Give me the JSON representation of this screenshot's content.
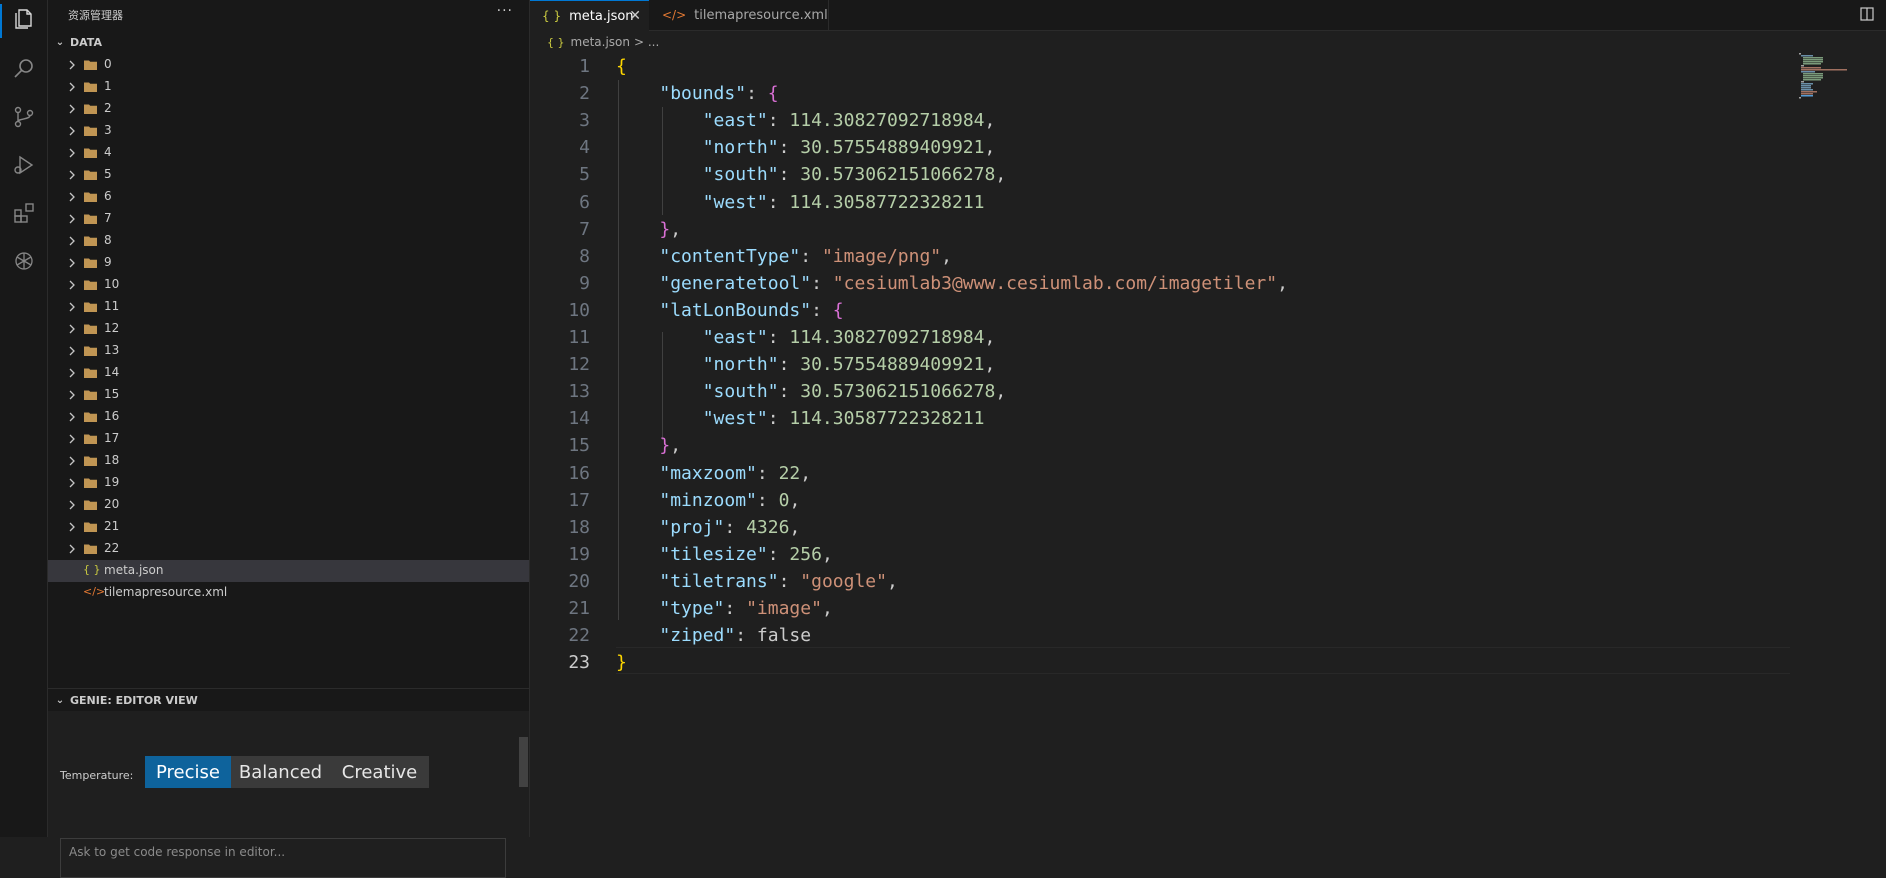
{
  "sidebar": {
    "title": "资源管理器",
    "more": "···",
    "root_label": "DATA",
    "folders": [
      "0",
      "1",
      "2",
      "3",
      "4",
      "5",
      "6",
      "7",
      "8",
      "9",
      "10",
      "11",
      "12",
      "13",
      "14",
      "15",
      "16",
      "17",
      "18",
      "19",
      "20",
      "21",
      "22"
    ],
    "files": [
      {
        "name": "meta.json",
        "icon": "{ }",
        "selected": true
      },
      {
        "name": "tilemapresource.xml",
        "icon": "</>",
        "selected": false
      }
    ]
  },
  "genie": {
    "header": "GENIE: EDITOR VIEW",
    "temperature_label": "Temperature:",
    "options": [
      "Precise",
      "Balanced",
      "Creative"
    ],
    "selected": "Precise",
    "input_placeholder": "Ask to get code response in editor..."
  },
  "tabs": [
    {
      "label": "meta.json",
      "icon": "{ }",
      "active": true
    },
    {
      "label": "tilemapresource.xml",
      "icon": "</>",
      "active": false
    }
  ],
  "breadcrumb": {
    "file": "meta.json",
    "rest": "> ..."
  },
  "editor": {
    "current_line": 23,
    "lines": [
      "{",
      "    \"bounds\": {",
      "        \"east\": 114.30827092718984,",
      "        \"north\": 30.57554889409921,",
      "        \"south\": 30.573062151066278,",
      "        \"west\": 114.30587722328211",
      "    },",
      "    \"contentType\": \"image/png\",",
      "    \"generatetool\": \"cesiumlab3@www.cesiumlab.com/imagetiler\",",
      "    \"latLonBounds\": {",
      "        \"east\": 114.30827092718984,",
      "        \"north\": 30.57554889409921,",
      "        \"south\": 30.573062151066278,",
      "        \"west\": 114.30587722328211",
      "    },",
      "    \"maxzoom\": 22,",
      "    \"minzoom\": 0,",
      "    \"proj\": 4326,",
      "    \"tilesize\": 256,",
      "    \"tiletrans\": \"google\",",
      "    \"type\": \"image\",",
      "    \"ziped\": false",
      "}"
    ]
  },
  "colors": {
    "accent": "#0078d4",
    "key": "#9cdcfe",
    "string": "#ce9178",
    "number": "#b5cea8",
    "boolean": "#569cd6",
    "brace": "#ffd700",
    "nested_brace": "#da70d6",
    "folder": "#dcb67a"
  },
  "activity_icons": [
    "explorer-icon",
    "search-icon",
    "source-control-icon",
    "run-debug-icon",
    "extensions-icon",
    "openai-icon"
  ]
}
